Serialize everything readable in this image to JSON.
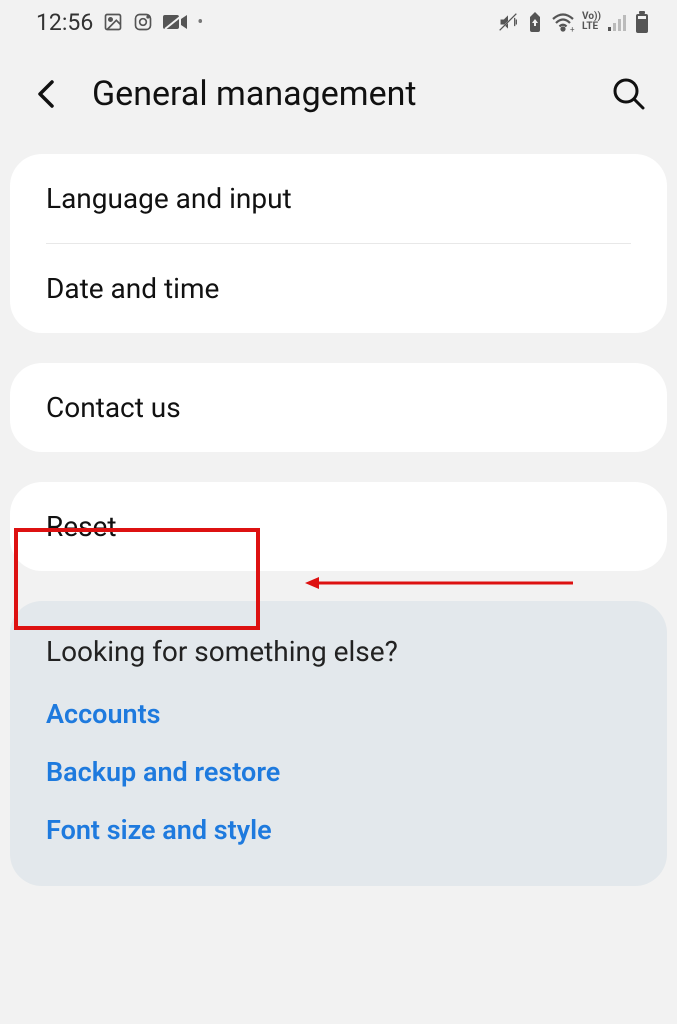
{
  "status_bar": {
    "time": "12:56"
  },
  "header": {
    "title": "General management"
  },
  "group1": {
    "item1": "Language and input",
    "item2": "Date and time"
  },
  "group2": {
    "item1": "Contact us"
  },
  "group3": {
    "item1": "Reset"
  },
  "suggestions": {
    "title": "Looking for something else?",
    "links": {
      "0": "Accounts",
      "1": "Backup and restore",
      "2": "Font size and style"
    }
  }
}
